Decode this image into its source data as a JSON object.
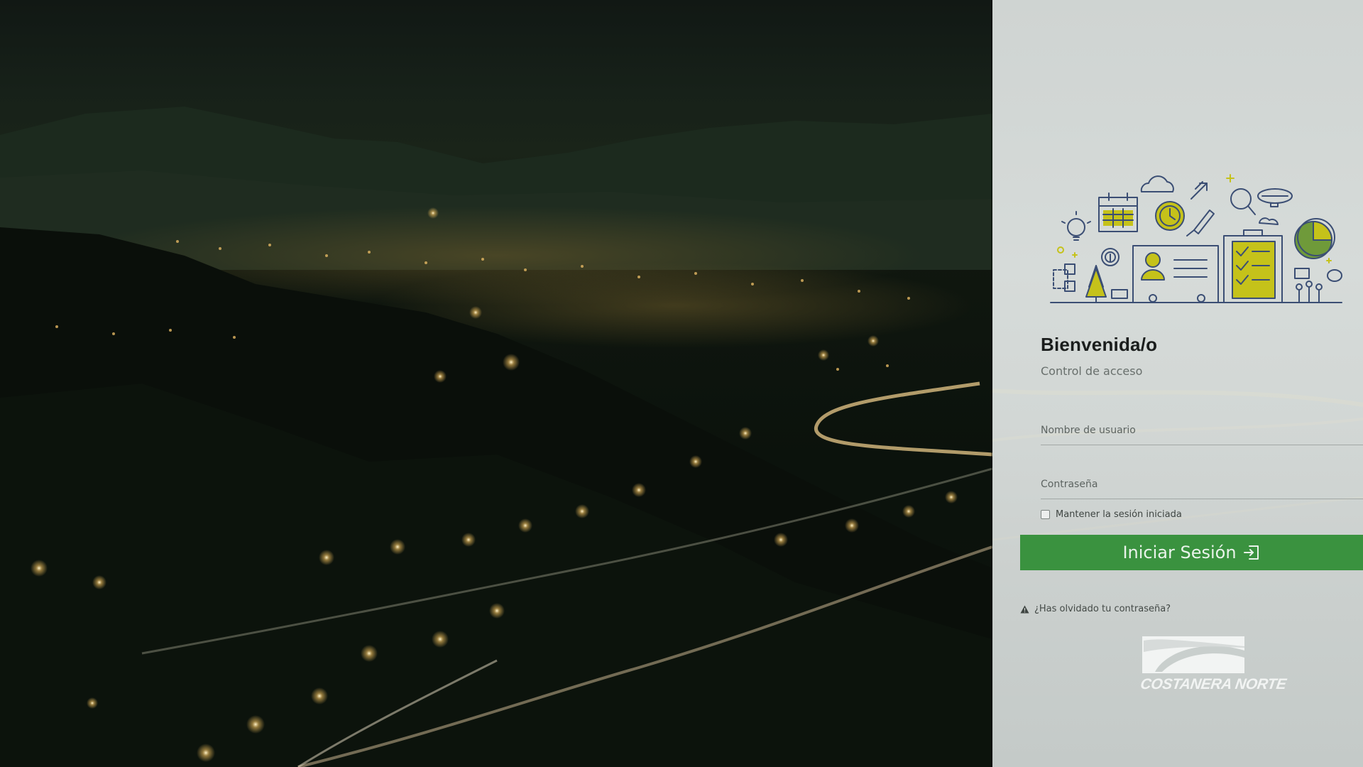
{
  "login": {
    "title": "Bienvenida/o",
    "subtitle": "Control de acceso",
    "username_placeholder": "Nombre de usuario",
    "password_placeholder": "Contraseña",
    "remember_label": "Mantener la sesión iniciada",
    "remember_checked": false,
    "submit_label": "Iniciar Sesión",
    "forgot_label": "¿Has olvidado tu contraseña?"
  },
  "brand": {
    "logo_text": "COSTANERA NORTE"
  },
  "icons": {
    "login_icon": "sign-in-icon",
    "forgot_icon": "warning-triangle-icon",
    "illustration": "office-tools-illustration"
  },
  "colors": {
    "primary_button": "#3a923f",
    "accent_yellow": "#c5c21a",
    "illustration_stroke": "#3b4e74",
    "panel_background": "#d5dad8"
  }
}
